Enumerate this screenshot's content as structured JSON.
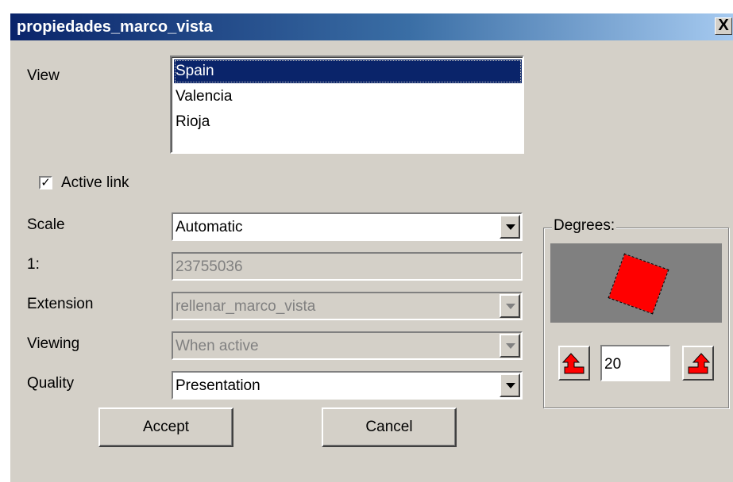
{
  "window": {
    "title": "propiedades_marco_vista",
    "close_label": "X"
  },
  "view": {
    "label": "View",
    "items": [
      {
        "label": "Spain",
        "selected": true
      },
      {
        "label": "Valencia",
        "selected": false
      },
      {
        "label": "Rioja",
        "selected": false
      }
    ]
  },
  "active_link": {
    "label": "Active link",
    "checked": true,
    "mark": "✓"
  },
  "scale": {
    "label": "Scale",
    "value": "Automatic"
  },
  "ratio": {
    "label": "1:",
    "value": "23755036"
  },
  "extension": {
    "label": "Extension",
    "value": "rellenar_marco_vista"
  },
  "viewing": {
    "label": "Viewing",
    "value": "When active"
  },
  "quality": {
    "label": "Quality",
    "value": "Presentation"
  },
  "buttons": {
    "accept": "Accept",
    "cancel": "Cancel"
  },
  "degrees": {
    "label": "Degrees:",
    "value": "20",
    "rotate_left_icon": "rotate-left-arrow-icon",
    "rotate_right_icon": "rotate-right-arrow-icon",
    "preview_color": "#808080",
    "shape_color": "#ff0000"
  }
}
